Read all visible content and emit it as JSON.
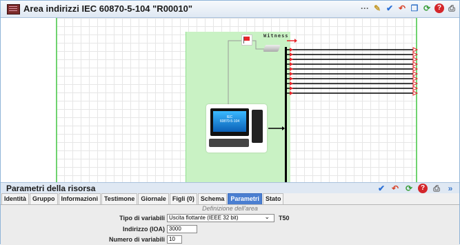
{
  "window": {
    "title": "Area indirizzi IEC 60870-5-104 \"R00010\"",
    "toolbar_icons": [
      "dots-icon",
      "edit-icon",
      "check-icon",
      "undo-icon",
      "copy-icon",
      "refresh-icon",
      "help-icon",
      "print-icon"
    ],
    "accent": "#a9c1dc"
  },
  "diagram": {
    "witness_label": "Witness",
    "device_screen_text": "IEC\n60870-5-104",
    "output_lines": 10,
    "bus_color": "#000000",
    "green_area_color": "#c9f2c4",
    "marker_color": "#e8262b"
  },
  "resource_panel": {
    "title": "Parametri della risorsa",
    "icons": [
      "check-icon",
      "undo-icon",
      "refresh-icon",
      "help-icon",
      "print-icon",
      "expand-icon"
    ],
    "tabs": [
      {
        "label": "Identità",
        "active": false
      },
      {
        "label": "Gruppo",
        "active": false
      },
      {
        "label": "Informazioni",
        "active": false
      },
      {
        "label": "Testimone",
        "active": false
      },
      {
        "label": "Giornale",
        "active": false
      },
      {
        "label": "Figli (0)",
        "active": false
      },
      {
        "label": "Schema",
        "active": false
      },
      {
        "label": "Parametri",
        "active": true
      },
      {
        "label": "Stato",
        "active": false
      }
    ]
  },
  "form": {
    "section_title": "Definizione dell'area",
    "variable_type_label": "Tipo di variabili",
    "variable_type_value": "Uscita flottante (IEEE 32 bit)",
    "type_code": "T50",
    "address_label": "Indirizzo (IOA)",
    "address_value": "3000",
    "count_label": "Numero di variabili",
    "count_value": "10"
  }
}
